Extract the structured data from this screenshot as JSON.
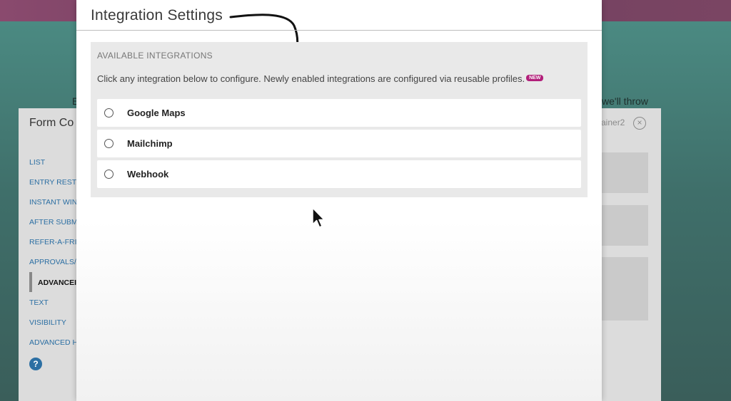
{
  "background": {
    "text_left": "E",
    "text_right": "we'll throw"
  },
  "form_container": {
    "title": "Form Co",
    "name": "ainer2",
    "close_glyph": "×",
    "help_glyph": "?",
    "nav_items": [
      {
        "label": "LIST"
      },
      {
        "label": "ENTRY RESTR"
      },
      {
        "label": "INSTANT WIN"
      },
      {
        "label": "AFTER SUBM"
      },
      {
        "label": "REFER-A-FRIE"
      },
      {
        "label": "APPROVALS/"
      },
      {
        "label": "ADVANCEI"
      },
      {
        "label": "TEXT"
      },
      {
        "label": "VISIBILITY"
      },
      {
        "label": "ADVANCED H"
      }
    ]
  },
  "modal": {
    "title": "Integration Settings",
    "panel": {
      "heading": "AVAILABLE INTEGRATIONS",
      "description": "Click any integration below to configure. Newly enabled integrations are configured via reusable profiles.",
      "badge": "NEW",
      "items": [
        {
          "label": "Google Maps"
        },
        {
          "label": "Mailchimp"
        },
        {
          "label": "Webhook"
        }
      ]
    }
  },
  "colors": {
    "teal_background": "#3f6f6a",
    "badge": "#b21f7a",
    "nav_link": "#2c6fa3"
  }
}
